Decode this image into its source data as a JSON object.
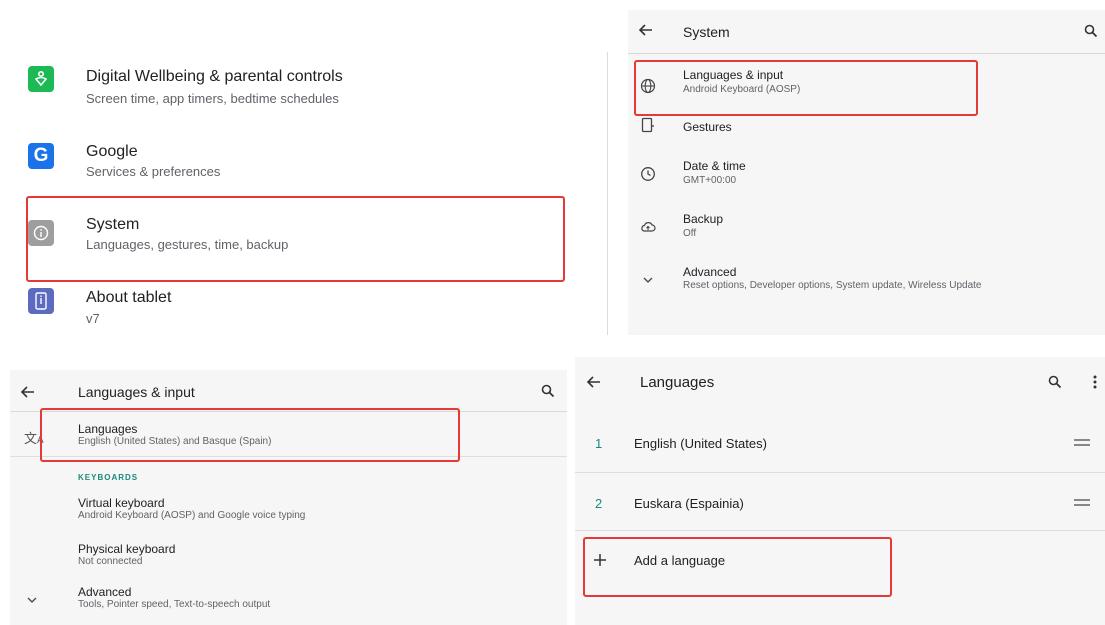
{
  "settings_list": {
    "items": [
      {
        "title": "Digital Wellbeing & parental controls",
        "subtitle": "Screen time, app timers, bedtime schedules",
        "icon": "wellbeing-icon",
        "color": "#1db954"
      },
      {
        "title": "Google",
        "subtitle": "Services & preferences",
        "icon": "google-icon",
        "color": "#1a73e8"
      },
      {
        "title": "System",
        "subtitle": "Languages, gestures, time, backup",
        "icon": "info-icon",
        "color": "#9e9e9e"
      },
      {
        "title": "About tablet",
        "subtitle": "v7",
        "icon": "tablet-icon",
        "color": "#5c6bc0"
      }
    ]
  },
  "system_screen": {
    "title": "System",
    "items": [
      {
        "title": "Languages & input",
        "subtitle": "Android Keyboard (AOSP)",
        "icon": "globe-icon"
      },
      {
        "title": "Gestures",
        "subtitle": "",
        "icon": "gestures-icon"
      },
      {
        "title": "Date & time",
        "subtitle": "GMT+00:00",
        "icon": "clock-icon"
      },
      {
        "title": "Backup",
        "subtitle": "Off",
        "icon": "cloud-upload-icon"
      },
      {
        "title": "Advanced",
        "subtitle": "Reset options, Developer options, System update, Wireless Update",
        "icon": "chevron-down-icon"
      }
    ]
  },
  "languages_input_screen": {
    "title": "Languages & input",
    "languages": {
      "title": "Languages",
      "subtitle": "English (United States) and Basque (Spain)",
      "icon": "translate-icon"
    },
    "keyboards_header": "KEYBOARDS",
    "virtual_keyboard": {
      "title": "Virtual keyboard",
      "subtitle": "Android Keyboard (AOSP) and Google voice typing"
    },
    "physical_keyboard": {
      "title": "Physical keyboard",
      "subtitle": "Not connected"
    },
    "advanced": {
      "title": "Advanced",
      "subtitle": "Tools, Pointer speed, Text-to-speech output",
      "icon": "chevron-down-icon"
    }
  },
  "languages_screen": {
    "title": "Languages",
    "languages": [
      {
        "number": "1",
        "name": "English (United States)"
      },
      {
        "number": "2",
        "name": "Euskara (Espainia)"
      }
    ],
    "add_language": "Add a language"
  },
  "colors": {
    "highlight": "#e53935",
    "accent": "#1a8a7a"
  }
}
